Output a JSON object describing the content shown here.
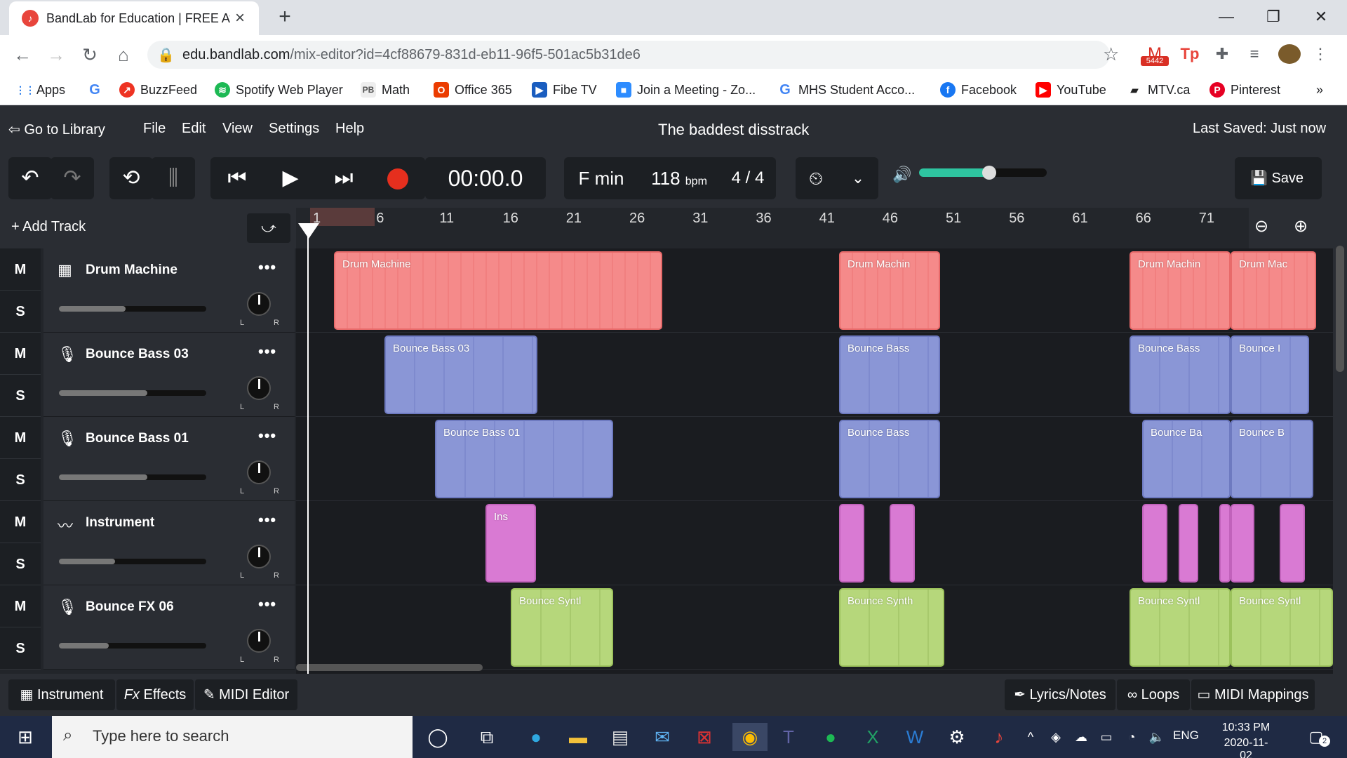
{
  "browser": {
    "tab_title": "BandLab for Education | FREE Aw",
    "url_host": "edu.bandlab.com",
    "url_path": "/mix-editor?id=4cf88679-831d-eb11-96f5-501ac5b31de6",
    "ext_badge": "5442",
    "bookmarks": [
      "Apps",
      "BuzzFeed",
      "Spotify Web Player",
      "Math",
      "Office 365",
      "Fibe TV",
      "Join a Meeting - Zo...",
      "MHS Student Acco...",
      "Facebook",
      "YouTube",
      "MTV.ca",
      "Pinterest"
    ],
    "bookmark_prefix_g": "G",
    "bookmark_math_prefix": "PB",
    "more_bookmarks": "»"
  },
  "app": {
    "go_library": "Go to Library",
    "menu": [
      "File",
      "Edit",
      "View",
      "Settings",
      "Help"
    ],
    "project_title": "The baddest disstrack",
    "last_saved": "Last Saved: Just now",
    "time": "00:00.0",
    "key": "F min",
    "bpm": "118",
    "bpm_unit": "bpm",
    "time_sig": "4 / 4",
    "master_volume": 0.55,
    "save": "Save",
    "add_track": "Add Track",
    "ruler_ticks": [
      "1",
      "6",
      "11",
      "16",
      "21",
      "26",
      "31",
      "36",
      "41",
      "46",
      "51",
      "56",
      "61",
      "66",
      "71"
    ],
    "mute_label": "M",
    "solo_label": "S",
    "pan_left": "L",
    "pan_right": "R",
    "tracks": [
      {
        "name": "Drum Machine",
        "volume": 0.45
      },
      {
        "name": "Bounce Bass 03",
        "volume": 0.6
      },
      {
        "name": "Bounce Bass 01",
        "volume": 0.6
      },
      {
        "name": "Instrument",
        "volume": 0.38
      },
      {
        "name": "Bounce FX 06",
        "volume": 0.34
      }
    ],
    "clips": {
      "drum": [
        "Drum Machine",
        "Drum Machin",
        "Drum Machin",
        "Drum Mac"
      ],
      "bass03": [
        "Bounce Bass 03",
        "Bounce Bass",
        "Bounce Bass",
        "Bounce I"
      ],
      "bass01": [
        "Bounce Bass 01",
        "Bounce Bass",
        "Bounce Ba",
        "Bounce B"
      ],
      "inst": [
        "Ins"
      ],
      "fx": [
        "Bounce Syntl",
        "Bounce Synth",
        "Bounce Syntl",
        "Bounce Syntl"
      ]
    },
    "bottom_left": [
      "Instrument",
      "Effects",
      "MIDI Editor"
    ],
    "fx_prefix": "Fx",
    "bottom_right": [
      "Lyrics/Notes",
      "Loops",
      "MIDI Mappings"
    ]
  },
  "taskbar": {
    "search_placeholder": "Type here to search",
    "lang": "ENG",
    "time": "10:33 PM",
    "date": "2020-11-02",
    "notif_count": "2"
  }
}
